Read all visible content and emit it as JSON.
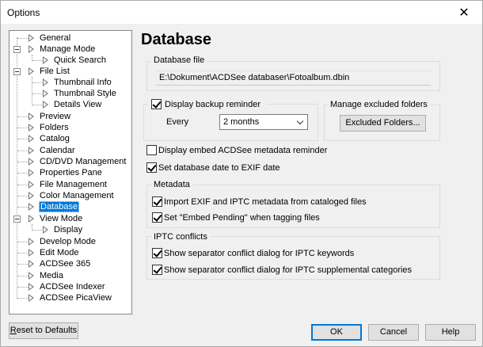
{
  "window": {
    "title": "Options",
    "close_glyph": "✕"
  },
  "tree": {
    "items": [
      {
        "label": "General"
      },
      {
        "label": "Manage Mode"
      },
      {
        "label": "Quick Search"
      },
      {
        "label": "File List"
      },
      {
        "label": "Thumbnail Info"
      },
      {
        "label": "Thumbnail Style"
      },
      {
        "label": "Details View"
      },
      {
        "label": "Preview"
      },
      {
        "label": "Folders"
      },
      {
        "label": "Catalog"
      },
      {
        "label": "Calendar"
      },
      {
        "label": "CD/DVD Management"
      },
      {
        "label": "Properties Pane"
      },
      {
        "label": "File Management"
      },
      {
        "label": "Color Management"
      },
      {
        "label": "Database",
        "selected": true
      },
      {
        "label": "View Mode"
      },
      {
        "label": "Display"
      },
      {
        "label": "Develop Mode"
      },
      {
        "label": "Edit Mode"
      },
      {
        "label": "ACDSee 365"
      },
      {
        "label": "Media"
      },
      {
        "label": "ACDSee Indexer"
      },
      {
        "label": "ACDSee PicaView"
      }
    ]
  },
  "page": {
    "title": "Database",
    "database_file": {
      "caption": "Database file",
      "path": "E:\\Dokument\\ACDSee databaser\\Fotoalbum.dbin"
    },
    "backup": {
      "checkbox_label": "Display backup reminder",
      "checked": true,
      "every_label": "Every",
      "every_value": "2 months"
    },
    "excluded": {
      "caption": "Manage excluded folders",
      "button": "Excluded Folders..."
    },
    "embed_reminder": {
      "label": "Display embed ACDSee metadata reminder",
      "checked": false
    },
    "exif_date": {
      "label": "Set database date to EXIF date",
      "checked": true
    },
    "metadata": {
      "caption": "Metadata",
      "import_label": "Import EXIF and IPTC metadata from cataloged files",
      "import_checked": true,
      "embed_pending_label": "Set \"Embed Pending\" when tagging files",
      "embed_pending_checked": true
    },
    "iptc": {
      "caption": "IPTC conflicts",
      "keywords_label": "Show separator conflict dialog for IPTC keywords",
      "keywords_checked": true,
      "supplemental_label": "Show separator conflict dialog for IPTC supplemental categories",
      "supplemental_checked": true
    }
  },
  "footer": {
    "reset_prefix": "R",
    "reset_rest": "eset to Defaults",
    "ok": "OK",
    "cancel": "Cancel",
    "help": "Help"
  },
  "colors": {
    "selection": "#0078d7",
    "background": "#f0f0f0"
  }
}
